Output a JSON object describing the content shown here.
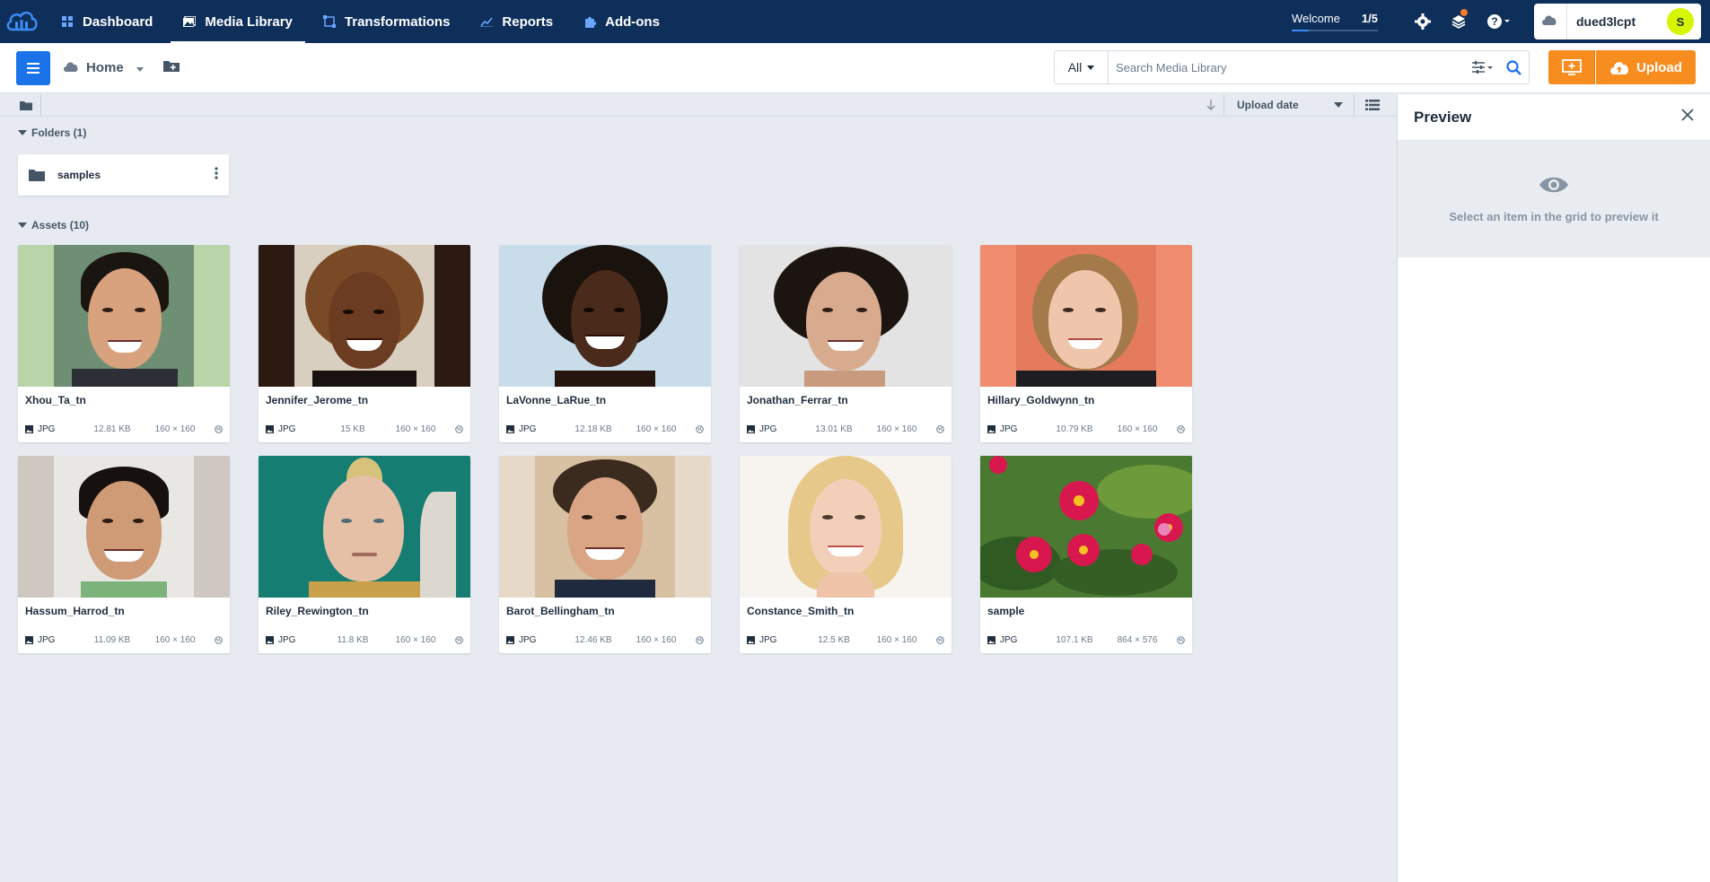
{
  "nav": {
    "items": [
      {
        "label": "Dashboard",
        "icon": "dashboard-icon"
      },
      {
        "label": "Media Library",
        "icon": "media-library-icon",
        "active": true
      },
      {
        "label": "Transformations",
        "icon": "transformations-icon"
      },
      {
        "label": "Reports",
        "icon": "reports-icon"
      },
      {
        "label": "Add-ons",
        "icon": "addons-icon"
      }
    ],
    "welcome_label": "Welcome",
    "welcome_progress": "1/5",
    "welcome_progress_fraction": 0.2,
    "account_name": "dued3lcpt",
    "avatar_letter": "S"
  },
  "toolbar": {
    "home_label": "Home",
    "search_scope": "All",
    "search_placeholder": "Search Media Library",
    "upload_label": "Upload"
  },
  "subbar": {
    "sort_label": "Upload date"
  },
  "folders": {
    "header": "Folders (1)",
    "items": [
      {
        "name": "samples"
      }
    ]
  },
  "assets": {
    "header": "Assets (10)",
    "items": [
      {
        "name": "Xhou_Ta_tn",
        "format": "JPG",
        "size": "12.81 KB",
        "dims": "160 × 160"
      },
      {
        "name": "Jennifer_Jerome_tn",
        "format": "JPG",
        "size": "15 KB",
        "dims": "160 × 160"
      },
      {
        "name": "LaVonne_LaRue_tn",
        "format": "JPG",
        "size": "12.18 KB",
        "dims": "160 × 160"
      },
      {
        "name": "Jonathan_Ferrar_tn",
        "format": "JPG",
        "size": "13.01 KB",
        "dims": "160 × 160"
      },
      {
        "name": "Hillary_Goldwynn_tn",
        "format": "JPG",
        "size": "10.79 KB",
        "dims": "160 × 160"
      },
      {
        "name": "Hassum_Harrod_tn",
        "format": "JPG",
        "size": "11.09 KB",
        "dims": "160 × 160"
      },
      {
        "name": "Riley_Rewington_tn",
        "format": "JPG",
        "size": "11.8 KB",
        "dims": "160 × 160"
      },
      {
        "name": "Barot_Bellingham_tn",
        "format": "JPG",
        "size": "12.46 KB",
        "dims": "160 × 160"
      },
      {
        "name": "Constance_Smith_tn",
        "format": "JPG",
        "size": "12.5 KB",
        "dims": "160 × 160"
      },
      {
        "name": "sample",
        "format": "JPG",
        "size": "107.1 KB",
        "dims": "864 × 576"
      }
    ]
  },
  "preview": {
    "title": "Preview",
    "empty_message": "Select an item in the grid to preview it"
  },
  "colors": {
    "nav_bg": "#0e2f5a",
    "accent_blue": "#1a73e8",
    "upload_orange": "#f78c1f",
    "page_bg": "#e7ebf1"
  }
}
